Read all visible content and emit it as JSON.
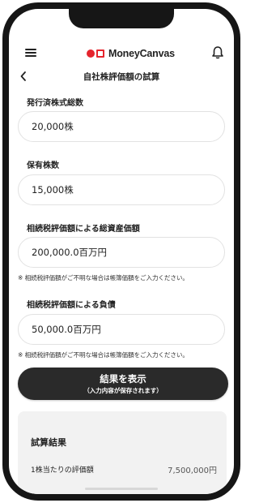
{
  "header": {
    "brand": "MoneyCanvas",
    "brand_color": "#e5242d",
    "menu_icon": "hamburger-menu-icon",
    "bell_icon": "bell-icon",
    "back_icon": "chevron-left-icon"
  },
  "page": {
    "title": "自社株評価額の試算"
  },
  "form": {
    "shares_issued": {
      "label": "発行済株式総数",
      "value": "20,000株"
    },
    "shares_held": {
      "label": "保有株数",
      "value": "15,000株"
    },
    "total_assets": {
      "label": "相続税評価額による総資産価額",
      "value": "200,000.0百万円",
      "note": "※ 相続税評価額がご不明な場合は帳簿価額をご入力ください。"
    },
    "liabilities": {
      "label": "相続税評価額による負債",
      "value": "50,000.0百万円",
      "note": "※ 相続税評価額がご不明な場合は帳簿価額をご入力ください。"
    },
    "submit": {
      "label": "結果を表示",
      "sublabel": "（入力内容が保存されます）"
    }
  },
  "result": {
    "title": "試算結果",
    "per_share_label": "1株当たりの評価額",
    "per_share_value": "7,500,000円"
  }
}
